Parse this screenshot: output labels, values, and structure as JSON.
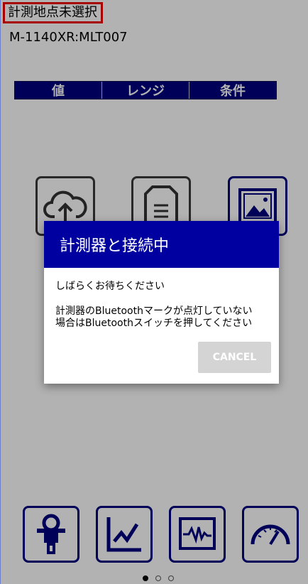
{
  "header": {
    "measurement_point": "計測地点未選択",
    "device_id": "M-1140XR:MLT007"
  },
  "tabs": [
    {
      "label": "値"
    },
    {
      "label": "レンジ"
    },
    {
      "label": "条件"
    }
  ],
  "mid_icons": [
    {
      "icon": "cloud-upload-icon"
    },
    {
      "icon": "document-icon"
    },
    {
      "icon": "image-icon",
      "selected": true
    }
  ],
  "bottom_icons": [
    {
      "icon": "clamp-meter-icon"
    },
    {
      "icon": "line-graph-icon"
    },
    {
      "icon": "waveform-icon"
    },
    {
      "icon": "gauge-icon"
    }
  ],
  "page_indicator": {
    "count": 3,
    "active": 1
  },
  "dialog": {
    "title": "計測器と接続中",
    "message": "しばらくお待ちください",
    "detail": "計測器のBluetoothマークが点灯していない\n場合はBluetoothスイッチを押してください",
    "cancel_label": "CANCEL"
  }
}
